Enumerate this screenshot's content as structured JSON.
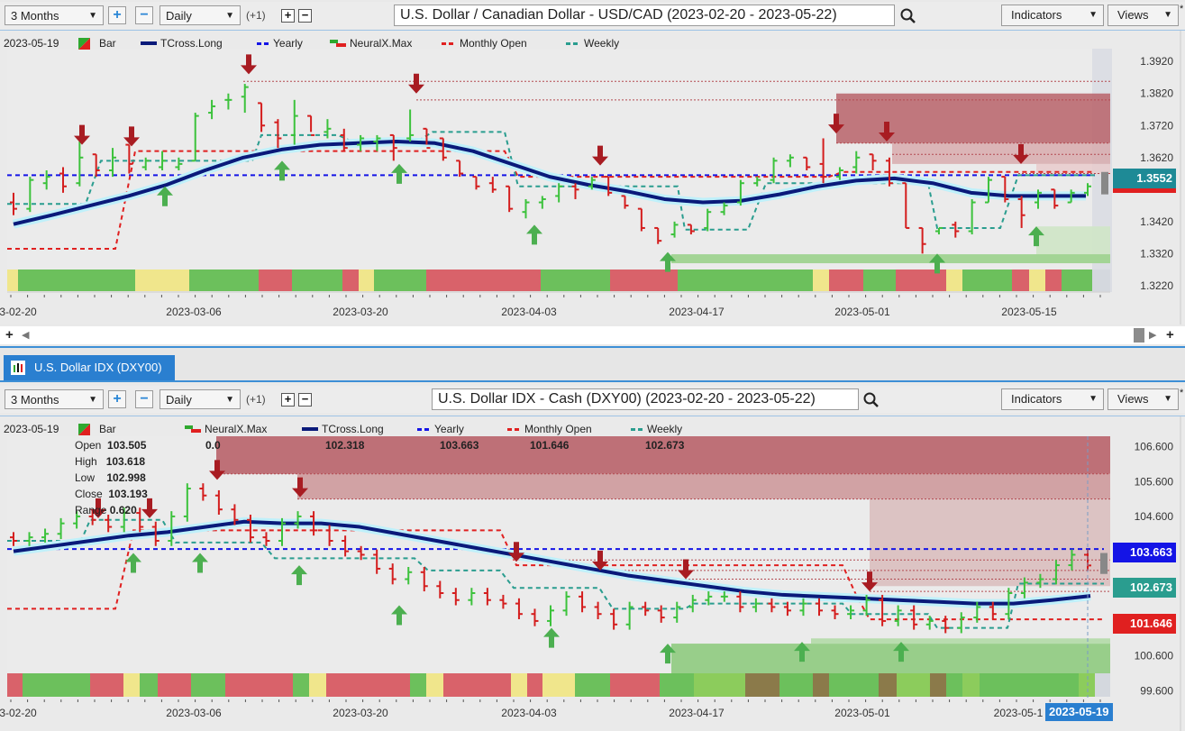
{
  "top": {
    "toolbar": {
      "range": "3 Months",
      "interval": "Daily",
      "offset": "(+1)",
      "title": "U.S. Dollar / Canadian Dollar - USD/CAD (2023-02-20 - 2023-05-22)",
      "indicators": "Indicators",
      "views": "Views",
      "modified_marker": "*"
    },
    "legend": {
      "date": "2023-05-19",
      "bar": "Bar",
      "tcross": "TCross.Long",
      "yearly": "Yearly",
      "neuralx": "NeuralX.Max",
      "monthly_open": "Monthly Open",
      "weekly": "Weekly"
    },
    "price_tag": "1.3552",
    "colors": {
      "price_tag": "#1e8a96",
      "monthly_tag": "#e02020"
    }
  },
  "bottom": {
    "tab": "U.S. Dollar IDX (DXY00)",
    "toolbar": {
      "range": "3 Months",
      "interval": "Daily",
      "offset": "(+1)",
      "title": "U.S. Dollar IDX - Cash (DXY00) (2023-02-20 - 2023-05-22)",
      "indicators": "Indicators",
      "views": "Views",
      "modified_marker": "*"
    },
    "legend": {
      "date": "2023-05-19",
      "bar": "Bar",
      "neuralx": "NeuralX.Max",
      "neuralx_value": "0.0",
      "tcross": "TCross.Long",
      "tcross_value": "102.318",
      "yearly": "Yearly",
      "yearly_value": "103.663",
      "monthly_open": "Monthly Open",
      "monthly_open_value": "101.646",
      "weekly": "Weekly",
      "weekly_value": "102.673"
    },
    "ohlc": {
      "open_label": "Open",
      "open": "103.505",
      "high_label": "High",
      "high": "103.618",
      "low_label": "Low",
      "low": "102.998",
      "close_label": "Close",
      "close": "103.193",
      "range_label": "Range",
      "range": "0.620"
    },
    "price_tags": {
      "yearly": "103.663",
      "weekly": "102.673",
      "monthly": "101.646"
    },
    "crosshair_date": "2023-05-19",
    "colors": {
      "yearly": "#1414e6",
      "weekly": "#2a9d8f",
      "monthly": "#e02020"
    }
  },
  "chart_data": [
    {
      "type": "ohlc",
      "title": "U.S. Dollar / Canadian Dollar - USD/CAD (2023-02-20 - 2023-05-22)",
      "x_ticks": [
        "3-02-20",
        "2023-03-06",
        "2023-03-20",
        "2023-04-03",
        "2023-04-17",
        "2023-05-01",
        "2023-05-15"
      ],
      "y_ticks": [
        "1.3920",
        "1.3820",
        "1.3720",
        "1.3620",
        "1.3420",
        "1.3320",
        "1.3220"
      ],
      "ylim": [
        1.32,
        1.396
      ],
      "levels": {
        "yearly": 1.3565,
        "monthly_open": 1.354,
        "last": 1.3552
      },
      "series": [
        {
          "name": "Bar",
          "ohlc": [
            [
              1.348,
              1.351,
              1.344,
              1.346
            ],
            [
              1.346,
              1.356,
              1.345,
              1.355
            ],
            [
              1.354,
              1.358,
              1.352,
              1.356
            ],
            [
              1.357,
              1.359,
              1.351,
              1.353
            ],
            [
              1.354,
              1.367,
              1.353,
              1.362
            ],
            [
              1.363,
              1.363,
              1.356,
              1.358
            ],
            [
              1.358,
              1.365,
              1.356,
              1.362
            ],
            [
              1.366,
              1.366,
              1.357,
              1.36
            ],
            [
              1.359,
              1.362,
              1.358,
              1.361
            ],
            [
              1.359,
              1.364,
              1.358,
              1.361
            ],
            [
              1.359,
              1.362,
              1.358,
              1.36
            ],
            [
              1.361,
              1.376,
              1.361,
              1.375
            ],
            [
              1.376,
              1.38,
              1.374,
              1.378
            ],
            [
              1.38,
              1.382,
              1.377,
              1.38
            ],
            [
              1.381,
              1.385,
              1.376,
              1.384
            ],
            [
              1.379,
              1.379,
              1.37,
              1.372
            ],
            [
              1.373,
              1.374,
              1.365,
              1.368
            ],
            [
              1.369,
              1.38,
              1.366,
              1.375
            ],
            [
              1.375,
              1.375,
              1.37,
              1.369
            ],
            [
              1.37,
              1.374,
              1.368,
              1.371
            ],
            [
              1.369,
              1.371,
              1.364,
              1.365
            ],
            [
              1.366,
              1.369,
              1.364,
              1.368
            ],
            [
              1.367,
              1.369,
              1.364,
              1.368
            ],
            [
              1.369,
              1.369,
              1.361,
              1.365
            ],
            [
              1.368,
              1.377,
              1.367,
              1.369
            ],
            [
              1.371,
              1.371,
              1.366,
              1.365
            ],
            [
              1.368,
              1.368,
              1.361,
              1.362
            ],
            [
              1.361,
              1.361,
              1.356,
              1.357
            ],
            [
              1.356,
              1.356,
              1.352,
              1.353
            ],
            [
              1.354,
              1.356,
              1.351,
              1.352
            ],
            [
              1.353,
              1.353,
              1.345,
              1.346
            ],
            [
              1.345,
              1.349,
              1.343,
              1.348
            ],
            [
              1.348,
              1.35,
              1.346,
              1.349
            ],
            [
              1.35,
              1.354,
              1.348,
              1.353
            ],
            [
              1.353,
              1.354,
              1.349,
              1.352
            ],
            [
              1.353,
              1.356,
              1.352,
              1.355
            ],
            [
              1.356,
              1.356,
              1.35,
              1.351
            ],
            [
              1.35,
              1.35,
              1.346,
              1.347
            ],
            [
              1.346,
              1.346,
              1.339,
              1.34
            ],
            [
              1.34,
              1.34,
              1.335,
              1.336
            ],
            [
              1.338,
              1.342,
              1.337,
              1.341
            ],
            [
              1.341,
              1.341,
              1.338,
              1.339
            ],
            [
              1.34,
              1.346,
              1.339,
              1.345
            ],
            [
              1.345,
              1.348,
              1.344,
              1.347
            ],
            [
              1.348,
              1.355,
              1.347,
              1.354
            ],
            [
              1.354,
              1.356,
              1.353,
              1.355
            ],
            [
              1.355,
              1.362,
              1.354,
              1.361
            ],
            [
              1.361,
              1.363,
              1.359,
              1.362
            ],
            [
              1.362,
              1.362,
              1.358,
              1.359
            ],
            [
              1.36,
              1.368,
              1.354,
              1.356
            ],
            [
              1.356,
              1.359,
              1.355,
              1.358
            ],
            [
              1.359,
              1.364,
              1.357,
              1.362
            ],
            [
              1.363,
              1.363,
              1.358,
              1.361
            ],
            [
              1.361,
              1.362,
              1.353,
              1.354
            ],
            [
              1.354,
              1.354,
              1.34,
              1.34
            ],
            [
              1.34,
              1.34,
              1.332,
              1.335
            ],
            [
              1.339,
              1.34,
              1.338,
              1.34
            ],
            [
              1.341,
              1.342,
              1.337,
              1.339
            ],
            [
              1.339,
              1.349,
              1.338,
              1.348
            ],
            [
              1.348,
              1.356,
              1.348,
              1.355
            ],
            [
              1.356,
              1.356,
              1.348,
              1.349
            ],
            [
              1.349,
              1.35,
              1.34,
              1.344
            ],
            [
              1.348,
              1.352,
              1.346,
              1.351
            ],
            [
              1.352,
              1.352,
              1.346,
              1.347
            ],
            [
              1.348,
              1.352,
              1.348,
              1.351
            ],
            [
              1.351,
              1.354,
              1.35,
              1.353
            ]
          ]
        },
        {
          "name": "TCross.Long",
          "values_sampled": [
            1.3412,
            1.344,
            1.347,
            1.35,
            1.3535,
            1.358,
            1.362,
            1.3645,
            1.366,
            1.3665,
            1.367,
            1.3665,
            1.364,
            1.36,
            1.356,
            1.3535,
            1.3515,
            1.349,
            1.348,
            1.3485,
            1.3505,
            1.353,
            1.3548,
            1.3555,
            1.354,
            1.351,
            1.35,
            1.35,
            1.35
          ]
        }
      ]
    },
    {
      "type": "ohlc",
      "title": "U.S. Dollar IDX - Cash (DXY00) (2023-02-20 - 2023-05-22)",
      "x_ticks": [
        "3-02-20",
        "2023-03-06",
        "2023-03-20",
        "2023-04-03",
        "2023-04-17",
        "2023-05-01",
        "2023-05-1",
        "2023-05-19"
      ],
      "y_ticks": [
        "106.600",
        "105.600",
        "104.600",
        "103.663",
        "102.673",
        "101.646",
        "100.600",
        "99.600"
      ],
      "ylim": [
        99.4,
        106.9
      ],
      "levels": {
        "yearly": 103.663,
        "weekly": 102.673,
        "monthly_open": 101.646,
        "tcross": 102.318
      },
      "last_bar": {
        "open": 103.505,
        "high": 103.618,
        "low": 102.998,
        "close": 103.193,
        "range": 0.62
      },
      "series": [
        {
          "name": "TCross.Long",
          "values_sampled": [
            103.6,
            103.75,
            103.9,
            104.05,
            104.15,
            104.3,
            104.45,
            104.4,
            104.4,
            104.3,
            104.1,
            103.9,
            103.7,
            103.5,
            103.3,
            103.1,
            102.9,
            102.75,
            102.6,
            102.45,
            102.35,
            102.3,
            102.25,
            102.2,
            102.15,
            102.1,
            102.1,
            102.2,
            102.318
          ]
        }
      ]
    }
  ]
}
